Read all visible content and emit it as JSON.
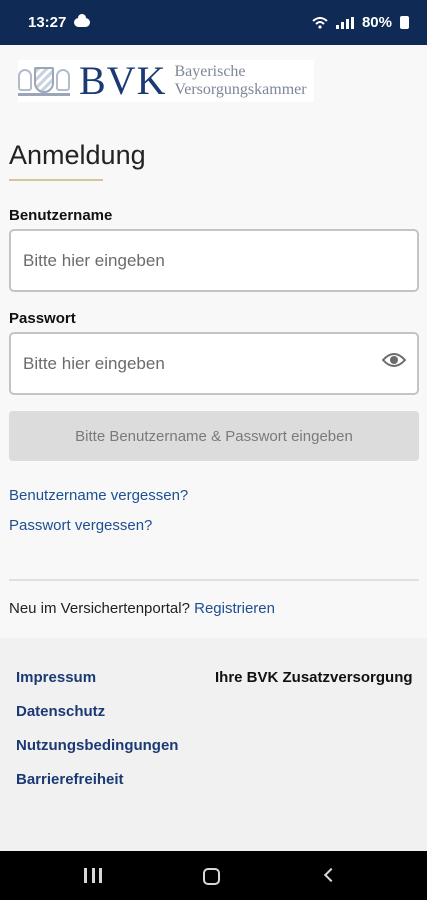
{
  "statusbar": {
    "time": "13:27",
    "battery": "80%",
    "cloud_icon": "cloud-icon",
    "wifi_icon": "wifi-icon",
    "signal_icon": "signal-icon",
    "battery_icon": "battery-icon"
  },
  "logo": {
    "mark": "BVK",
    "line1": "Bayerische",
    "line2": "Versorgungskammer"
  },
  "title": "Anmeldung",
  "username": {
    "label": "Benutzername",
    "placeholder": "Bitte hier eingeben",
    "value": ""
  },
  "password": {
    "label": "Passwort",
    "placeholder": "Bitte hier eingeben",
    "value": "",
    "toggle_icon": "eye-icon"
  },
  "submit": {
    "label": "Bitte Benutzername & Passwort eingeben",
    "enabled": false
  },
  "links": {
    "forgot_username": "Benutzername vergessen?",
    "forgot_password": "Passwort vergessen?"
  },
  "register": {
    "prompt": "Neu im Versichertenportal?",
    "link": "Registrieren"
  },
  "footer": {
    "links": [
      "Impressum",
      "Datenschutz",
      "Nutzungsbedingungen",
      "Barrierefreiheit"
    ],
    "right_label": "Ihre BVK Zusatzversorgung"
  },
  "navbar": {
    "recent_icon": "recent-apps-icon",
    "home_icon": "home-icon",
    "back_icon": "back-icon"
  },
  "colors": {
    "brand_navy": "#0f2a54",
    "link_blue": "#1d4f91",
    "accent_gold": "#d7c49a",
    "disabled_button": "#dcdcdc"
  }
}
